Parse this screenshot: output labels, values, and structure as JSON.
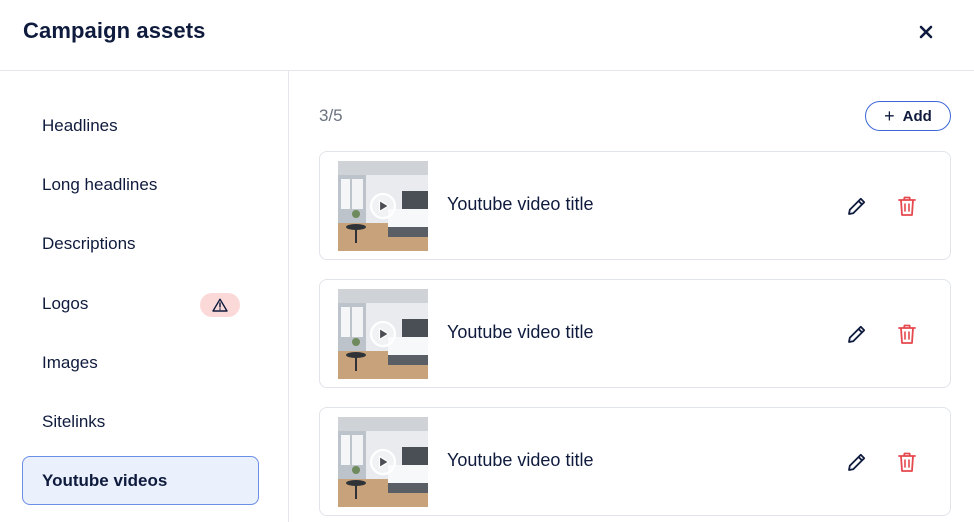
{
  "header": {
    "title": "Campaign assets",
    "close_icon": "close-icon"
  },
  "sidebar": {
    "items": [
      {
        "label": "Headlines"
      },
      {
        "label": "Long headlines"
      },
      {
        "label": "Descriptions"
      },
      {
        "label": "Logos",
        "badge_icon": "warning-icon"
      },
      {
        "label": "Images"
      },
      {
        "label": "Sitelinks"
      },
      {
        "label": "Youtube videos",
        "active": true
      }
    ]
  },
  "main": {
    "counter": "3/5",
    "add_label": "Add",
    "videos": [
      {
        "title": "Youtube video title",
        "thumbnail_icon": "play-icon"
      },
      {
        "title": "Youtube video title",
        "thumbnail_icon": "play-icon"
      },
      {
        "title": "Youtube video title",
        "thumbnail_icon": "play-icon"
      }
    ]
  },
  "colors": {
    "text": "#0f1b3d",
    "accent": "#3b66d6",
    "active_bg": "#eaf0fc",
    "danger": "#e5484d",
    "warning_bg": "#fbd9d9"
  }
}
